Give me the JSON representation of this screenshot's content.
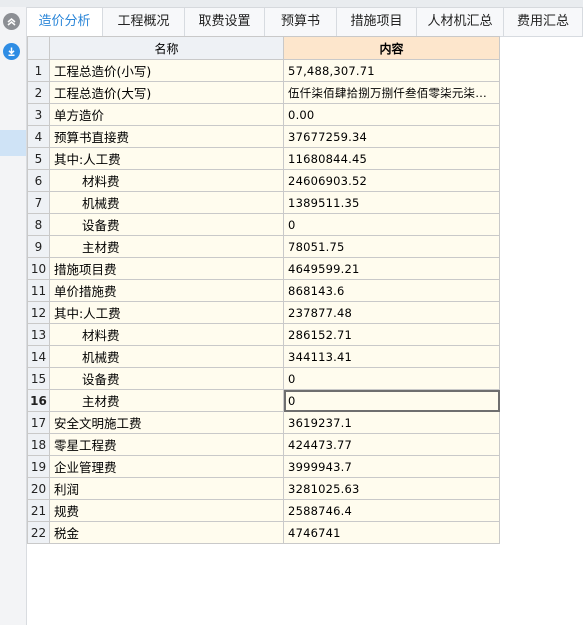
{
  "tabs": [
    {
      "label": "造价分析",
      "active": true
    },
    {
      "label": "工程概况"
    },
    {
      "label": "取费设置"
    },
    {
      "label": "预算书"
    },
    {
      "label": "措施项目"
    },
    {
      "label": "人材机汇总"
    },
    {
      "label": "费用汇总"
    }
  ],
  "table": {
    "headers": {
      "name": "名称",
      "content": "内容"
    },
    "current_row": "16",
    "rows": [
      {
        "idx": "1",
        "name": "工程总造价(小写)",
        "value": "57,488,307.71"
      },
      {
        "idx": "2",
        "name": "工程总造价(大写)",
        "value": "伍仟柒佰肆拾捌万捌仟叁佰零柒元柒…"
      },
      {
        "idx": "3",
        "name": "单方造价",
        "value": "0.00"
      },
      {
        "idx": "4",
        "name": "预算书直接费",
        "value": "37677259.34"
      },
      {
        "idx": "5",
        "name": "其中:人工费",
        "value": "11680844.45"
      },
      {
        "idx": "6",
        "name": "材料费",
        "value": "24606903.52",
        "indent": true
      },
      {
        "idx": "7",
        "name": "机械费",
        "value": "1389511.35",
        "indent": true
      },
      {
        "idx": "8",
        "name": "设备费",
        "value": "0",
        "indent": true
      },
      {
        "idx": "9",
        "name": "主材费",
        "value": "78051.75",
        "indent": true
      },
      {
        "idx": "10",
        "name": "措施项目费",
        "value": "4649599.21"
      },
      {
        "idx": "11",
        "name": "单价措施费",
        "value": "868143.6"
      },
      {
        "idx": "12",
        "name": "其中:人工费",
        "value": "237877.48"
      },
      {
        "idx": "13",
        "name": "材料费",
        "value": "286152.71",
        "indent": true
      },
      {
        "idx": "14",
        "name": "机械费",
        "value": "344113.41",
        "indent": true
      },
      {
        "idx": "15",
        "name": "设备费",
        "value": "0",
        "indent": true
      },
      {
        "idx": "16",
        "name": "主材费",
        "value": "0",
        "indent": true
      },
      {
        "idx": "17",
        "name": "安全文明施工费",
        "value": "3619237.1"
      },
      {
        "idx": "18",
        "name": "零星工程费",
        "value": "424473.77"
      },
      {
        "idx": "19",
        "name": "企业管理费",
        "value": "3999943.7"
      },
      {
        "idx": "20",
        "name": "利润",
        "value": "3281025.63"
      },
      {
        "idx": "21",
        "name": "规费",
        "value": "2588746.4"
      },
      {
        "idx": "22",
        "name": "税金",
        "value": "4746741"
      }
    ]
  },
  "icons": {
    "collapse": "double-chevron-up-icon",
    "download": "download-icon"
  }
}
